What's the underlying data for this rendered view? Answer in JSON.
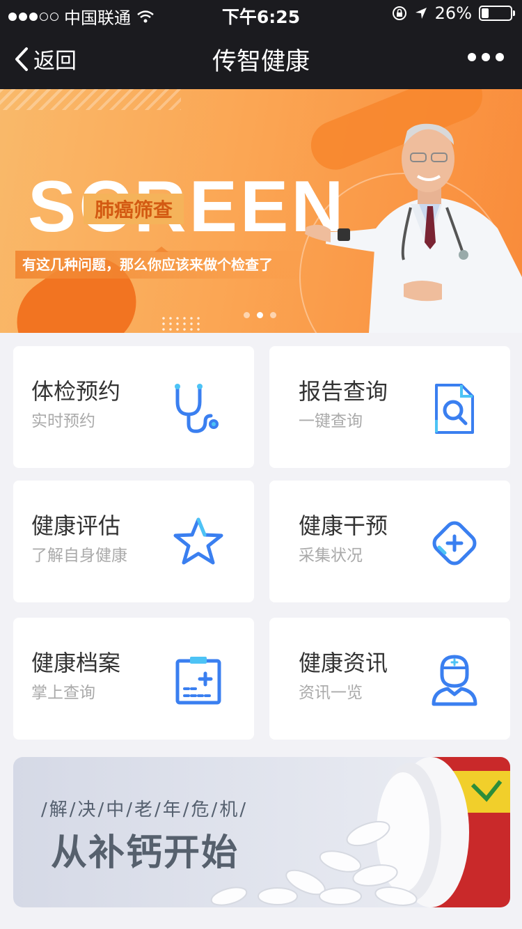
{
  "status_bar": {
    "carrier": "中国联通",
    "time": "下午6:25",
    "battery_percent": "26%",
    "battery_level": 0.26
  },
  "nav": {
    "back_label": "返回",
    "title": "传智健康"
  },
  "banner": {
    "big_text": "SCREEN",
    "tag": "肺癌筛查",
    "subtitle": "有这几种问题，那么你应该来做个检查了",
    "pages": 3,
    "active_page": 2
  },
  "services": [
    {
      "title": "体检预约",
      "subtitle": "实时预约",
      "icon": "stethoscope-icon"
    },
    {
      "title": "报告查询",
      "subtitle": "一键查询",
      "icon": "report-search-icon"
    },
    {
      "title": "健康评估",
      "subtitle": "了解自身健康",
      "icon": "star-icon"
    },
    {
      "title": "健康干预",
      "subtitle": "采集状况",
      "icon": "plus-diamond-icon"
    },
    {
      "title": "健康档案",
      "subtitle": "掌上查询",
      "icon": "medical-record-icon"
    },
    {
      "title": "健康资讯",
      "subtitle": "资讯一览",
      "icon": "nurse-icon"
    }
  ],
  "promo": {
    "small_text": "/解/决/中/老/年/危/机/",
    "big_text": "从补钙开始"
  },
  "colors": {
    "nav_bg": "#1b1b1f",
    "banner_orange": "#fba654",
    "icon_blue": "#3a7ff0",
    "page_bg": "#f2f2f6"
  }
}
